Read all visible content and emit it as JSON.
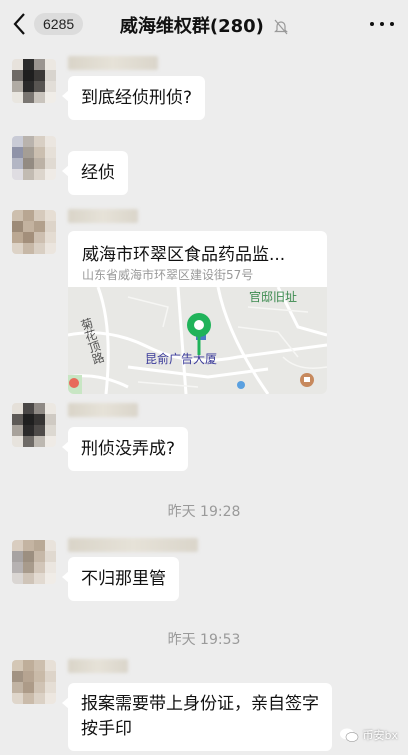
{
  "header": {
    "unread_count": "6285",
    "title": "威海维权群(280)",
    "icons": {
      "back": "chevron-left-icon",
      "mute": "bell-off-icon",
      "more": "more-dots-icon"
    }
  },
  "messages": [
    {
      "text": "到底经侦刑侦?"
    },
    {
      "text": "经侦"
    },
    {
      "location": {
        "title": "威海市环翠区食品药品监...",
        "address": "山东省威海市环翠区建设街57号",
        "map_labels": {
          "poi_top": "官邸旧址",
          "road": "菊花顶路",
          "pin": "昆俞广告大厦"
        }
      }
    },
    {
      "text": "刑侦没弄成?"
    },
    {
      "text": "不归那里管"
    },
    {
      "text": "报案需要带上身份证，亲自签字按手印"
    }
  ],
  "timestamps": [
    "昨天 19:28",
    "昨天 19:53"
  ],
  "watermark": {
    "text": "币安bx"
  },
  "colors": {
    "background": "#ededed",
    "bubble": "#ffffff",
    "pin": "#20b35a",
    "timestamp": "#9a9a9a"
  }
}
